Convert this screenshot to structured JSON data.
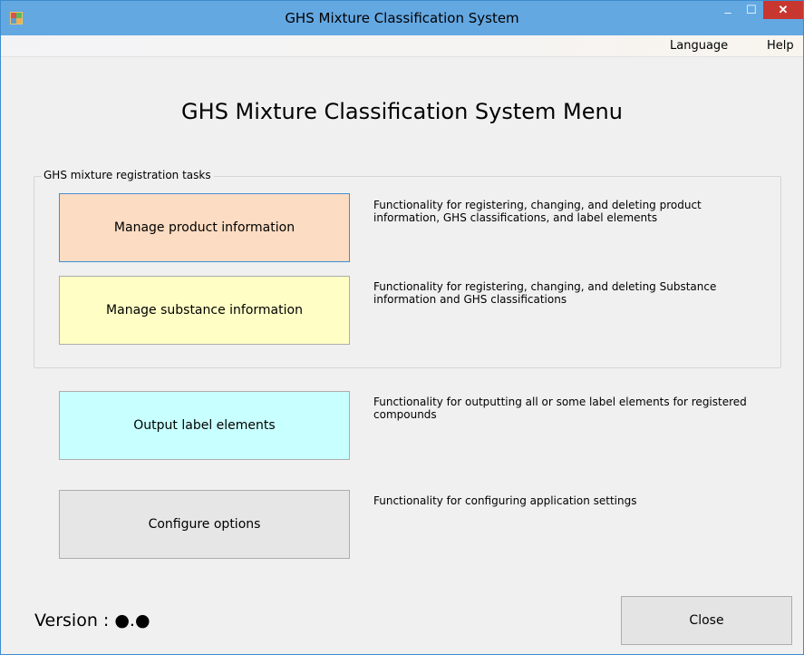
{
  "window": {
    "title": "GHS Mixture Classification System",
    "minimize_symbol": "‒",
    "maximize_symbol": "☐",
    "close_symbol": "✕",
    "titlebar_color": "#64a8e2",
    "close_color": "#c7372f"
  },
  "menu": {
    "language": "Language",
    "help": "Help"
  },
  "main": {
    "title": "GHS Mixture Classification System Menu"
  },
  "registration_group": {
    "label": "GHS mixture registration tasks"
  },
  "buttons": {
    "product": {
      "label": "Manage product information",
      "description": "Functionality for registering, changing, and deleting product information, GHS classifications, and label elements",
      "color": "#fcdcc2"
    },
    "substance": {
      "label": "Manage substance information",
      "description": "Functionality for registering, changing, and deleting Substance information and GHS classifications",
      "color": "#ffffc5"
    },
    "output": {
      "label": "Output label elements",
      "description": "Functionality for outputting all or some label elements for registered compounds",
      "color": "#c8ffff"
    },
    "options": {
      "label": "Configure options",
      "description": "Functionality for configuring application settings",
      "color": "#e6e6e6"
    }
  },
  "footer": {
    "version": "Version : ●.●",
    "close_label": "Close"
  }
}
